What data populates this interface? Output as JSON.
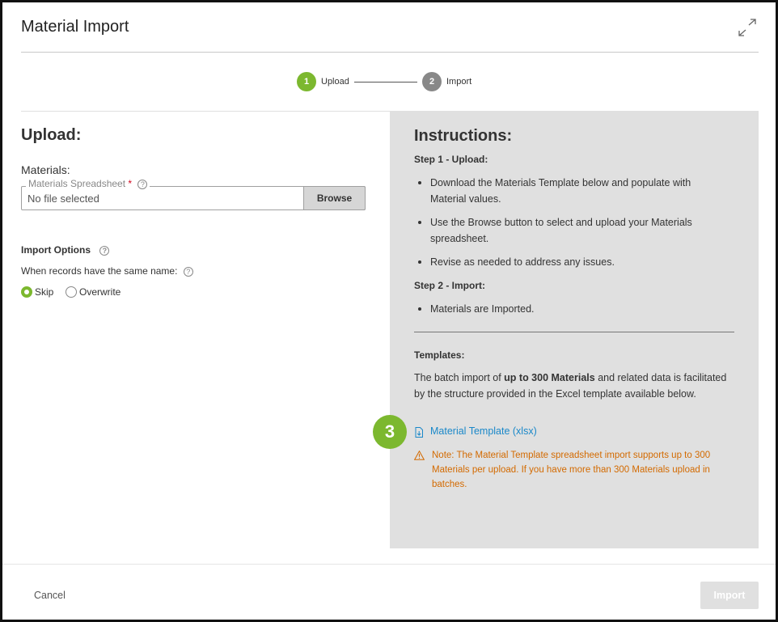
{
  "dialog": {
    "title": "Material Import"
  },
  "stepper": {
    "steps": [
      {
        "number": "1",
        "label": "Upload",
        "state": "active",
        "color": "#7cb82f"
      },
      {
        "number": "2",
        "label": "Import",
        "state": "pending",
        "color": "#888888"
      }
    ]
  },
  "upload": {
    "heading": "Upload:",
    "materials_label": "Materials:",
    "field_label": "Materials Spreadsheet",
    "required_mark": "*",
    "help_glyph": "?",
    "file_value": "No file selected",
    "browse_label": "Browse"
  },
  "import_options": {
    "heading": "Import Options",
    "same_name_label": "When records have the same name:",
    "options": [
      {
        "label": "Skip",
        "selected": true
      },
      {
        "label": "Overwrite",
        "selected": false
      }
    ]
  },
  "instructions": {
    "heading": "Instructions:",
    "step1_heading": "Step 1 - Upload:",
    "step1_bullets": [
      "Download the Materials Template below and populate with Material values.",
      "Use the Browse button to select and upload your Materials spreadsheet.",
      "Revise as needed to address any issues."
    ],
    "step2_heading": "Step 2 - Import:",
    "step2_bullets": [
      "Materials are Imported."
    ],
    "templates_heading": "Templates:",
    "templates_text_before": "The batch import of ",
    "templates_text_bold": "up to 300 Materials",
    "templates_text_after": " and related data is facilitated by the structure provided in the Excel template available below.",
    "template_link": "Material Template (xlsx)",
    "note": "Note: The Material Template spreadsheet import supports up to 300 Materials per upload. If you have more than 300 Materials upload in batches.",
    "note_color": "#d36a00"
  },
  "callout": {
    "number": "3",
    "color": "#7cb82f"
  },
  "footer": {
    "cancel_label": "Cancel",
    "import_label": "Import"
  }
}
